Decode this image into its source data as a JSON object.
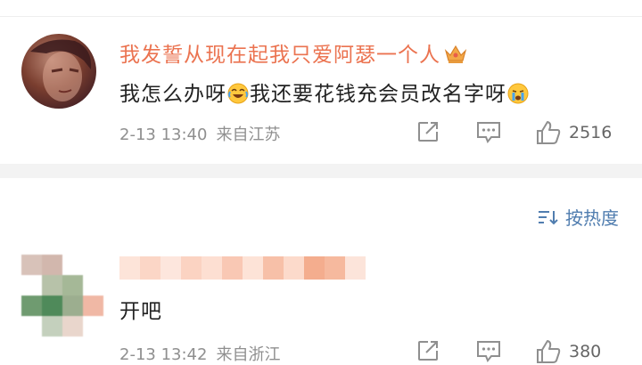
{
  "comments": [
    {
      "username": "我发誓从现在起我只爱阿瑟一个人",
      "text_part1": "我怎么办呀",
      "text_part2": "我还要花钱充会员改名字呀",
      "date": "2-13 13:40",
      "location": "来自江苏",
      "like_count": "2516",
      "icons": [
        "crown-icon",
        "laugh-cry-emoji",
        "crying-emoji",
        "repost-icon",
        "reply-icon",
        "like-icon"
      ]
    },
    {
      "username_hidden": true,
      "text": "开吧",
      "date": "2-13 13:42",
      "location": "来自浙江",
      "like_count": "380",
      "icons": [
        "repost-icon",
        "reply-icon",
        "like-icon"
      ]
    }
  ],
  "sort": {
    "label": "按热度",
    "icon": "sort-icon"
  },
  "colors": {
    "username": "#eb7350",
    "meta": "#8f8f8f",
    "link": "#507daf",
    "divider": "#f3f3f3"
  }
}
